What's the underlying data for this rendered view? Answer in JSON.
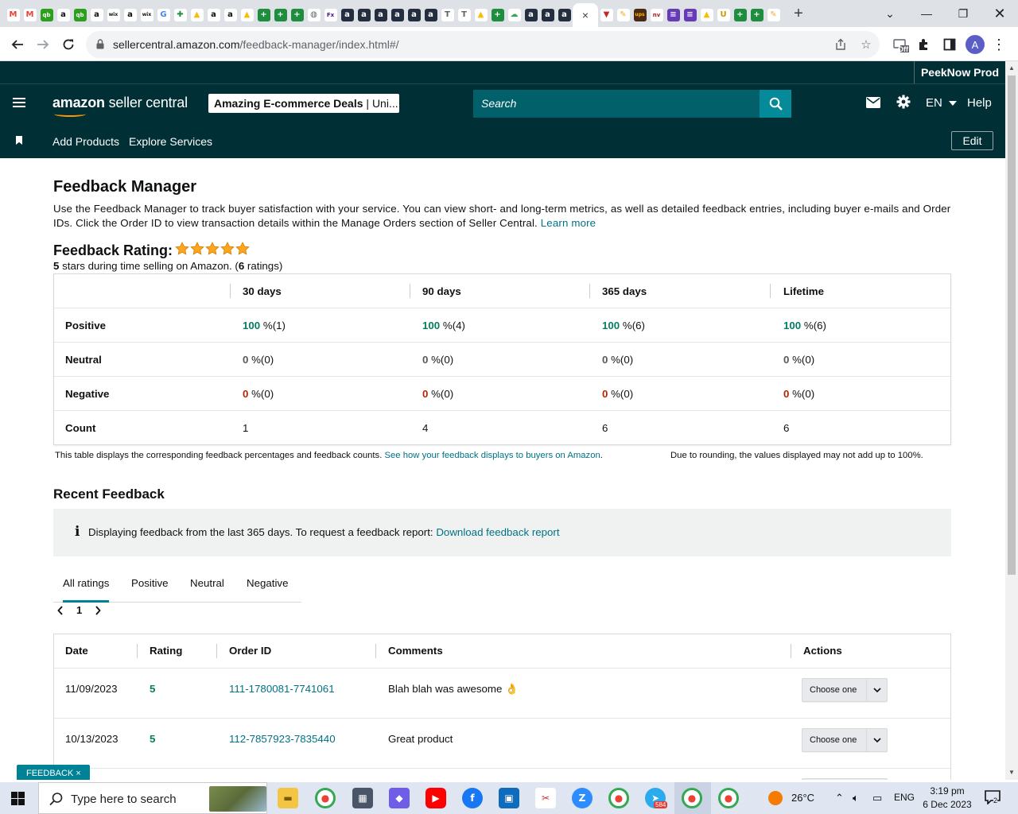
{
  "browser": {
    "active_tab_close": "×",
    "new_tab": "+",
    "tab_favicons": [
      {
        "icon": "gmail-icon",
        "bg": "#ffffff",
        "fg": "#ea4335",
        "glyph": "M"
      },
      {
        "icon": "gmail-icon",
        "bg": "#ffffff",
        "fg": "#ea4335",
        "glyph": "M"
      },
      {
        "icon": "quickbooks-icon",
        "bg": "#2ca01c",
        "fg": "#fff",
        "glyph": "qb"
      },
      {
        "icon": "amazon-icon",
        "bg": "#ffffff",
        "fg": "#111",
        "glyph": "a"
      },
      {
        "icon": "quickbooks-icon",
        "bg": "#2ca01c",
        "fg": "#fff",
        "glyph": "qb"
      },
      {
        "icon": "amazon-icon",
        "bg": "#ffffff",
        "fg": "#111",
        "glyph": "a"
      },
      {
        "icon": "wix-icon",
        "bg": "#ffffff",
        "fg": "#111",
        "glyph": "wix"
      },
      {
        "icon": "amazon-icon",
        "bg": "#ffffff",
        "fg": "#111",
        "glyph": "a"
      },
      {
        "icon": "wix-icon",
        "bg": "#ffffff",
        "fg": "#111",
        "glyph": "wix"
      },
      {
        "icon": "google-icon",
        "bg": "#ffffff",
        "fg": "#4285f4",
        "glyph": "G"
      },
      {
        "icon": "puzzle-icon",
        "bg": "#ffffff",
        "fg": "#1e8e3e",
        "glyph": "✚"
      },
      {
        "icon": "drive-icon",
        "bg": "#ffffff",
        "fg": "#fbbc04",
        "glyph": "▲"
      },
      {
        "icon": "amazon-icon",
        "bg": "#ffffff",
        "fg": "#111",
        "glyph": "a"
      },
      {
        "icon": "amazon-icon",
        "bg": "#ffffff",
        "fg": "#111",
        "glyph": "a"
      },
      {
        "icon": "drive-icon",
        "bg": "#ffffff",
        "fg": "#fbbc04",
        "glyph": "▲"
      },
      {
        "icon": "sheets-plus-icon",
        "bg": "#1e8e3e",
        "fg": "#fff",
        "glyph": "+"
      },
      {
        "icon": "sheets-plus-icon",
        "bg": "#1e8e3e",
        "fg": "#fff",
        "glyph": "+"
      },
      {
        "icon": "sheets-plus-icon",
        "bg": "#1e8e3e",
        "fg": "#fff",
        "glyph": "+"
      },
      {
        "icon": "globe-icon",
        "bg": "#ffffff",
        "fg": "#5f6368",
        "glyph": "◍"
      },
      {
        "icon": "fedex-icon",
        "bg": "#ffffff",
        "fg": "#4d148c",
        "glyph": "Fx"
      },
      {
        "icon": "amazon-box-icon",
        "bg": "#232f3e",
        "fg": "#fff",
        "glyph": "a"
      },
      {
        "icon": "amazon-box-icon",
        "bg": "#232f3e",
        "fg": "#fff",
        "glyph": "a"
      },
      {
        "icon": "amazon-box-icon",
        "bg": "#232f3e",
        "fg": "#fff",
        "glyph": "a"
      },
      {
        "icon": "amazon-box-icon",
        "bg": "#232f3e",
        "fg": "#fff",
        "glyph": "a"
      },
      {
        "icon": "amazon-box-icon",
        "bg": "#232f3e",
        "fg": "#fff",
        "glyph": "a"
      },
      {
        "icon": "amazon-box-icon",
        "bg": "#232f3e",
        "fg": "#fff",
        "glyph": "a"
      },
      {
        "icon": "typography-icon",
        "bg": "#ffffff",
        "fg": "#5f6368",
        "glyph": "T"
      },
      {
        "icon": "typography-icon",
        "bg": "#ffffff",
        "fg": "#5f6368",
        "glyph": "T"
      },
      {
        "icon": "drive-icon",
        "bg": "#ffffff",
        "fg": "#fbbc04",
        "glyph": "▲"
      },
      {
        "icon": "sheets-plus-icon",
        "bg": "#1e8e3e",
        "fg": "#fff",
        "glyph": "+"
      },
      {
        "icon": "cloud-icon",
        "bg": "#ffffff",
        "fg": "#34a853",
        "glyph": "☁"
      },
      {
        "icon": "amazon-box-icon",
        "bg": "#232f3e",
        "fg": "#fff",
        "glyph": "a"
      },
      {
        "icon": "amazon-box-icon",
        "bg": "#232f3e",
        "fg": "#fff",
        "glyph": "a"
      },
      {
        "icon": "amazon-box-icon",
        "bg": "#232f3e",
        "fg": "#fff",
        "glyph": "a"
      }
    ],
    "tab_favicons_right": [
      {
        "icon": "vivaldi-icon",
        "bg": "#ffffff",
        "fg": "#c62828",
        "glyph": "▼"
      },
      {
        "icon": "pencil-icon",
        "bg": "#ffffff",
        "fg": "#f9a825",
        "glyph": "✎"
      },
      {
        "icon": "ups-icon",
        "bg": "#4a2a12",
        "fg": "#ffb500",
        "glyph": "ups"
      },
      {
        "icon": "nav-icon",
        "bg": "#ffffff",
        "fg": "#b71c1c",
        "glyph": "nv"
      },
      {
        "icon": "forms-icon",
        "bg": "#673ab7",
        "fg": "#fff",
        "glyph": "≡"
      },
      {
        "icon": "forms-icon",
        "bg": "#673ab7",
        "fg": "#fff",
        "glyph": "≡"
      },
      {
        "icon": "drive-icon",
        "bg": "#ffffff",
        "fg": "#fbbc04",
        "glyph": "▲"
      },
      {
        "icon": "uline-icon",
        "bg": "#ffffff",
        "fg": "#c99700",
        "glyph": "U"
      },
      {
        "icon": "sheets-plus-icon",
        "bg": "#1e8e3e",
        "fg": "#fff",
        "glyph": "+"
      },
      {
        "icon": "sheets-plus-icon",
        "bg": "#1e8e3e",
        "fg": "#fff",
        "glyph": "+"
      },
      {
        "icon": "pencil-icon",
        "bg": "#ffffff",
        "fg": "#f9a825",
        "glyph": "✎"
      }
    ],
    "url_host": "sellercentral.amazon.com",
    "url_path": "/feedback-manager/index.html#/",
    "profile_initial": "A",
    "extension_badge": "Off"
  },
  "header": {
    "account_name": "PeekNow Prod",
    "logo_primary": "amazon",
    "logo_secondary": " seller central",
    "store_name": "Amazing E-commerce Deals",
    "store_market": " | Uni...",
    "search_placeholder": "Search",
    "language": "EN",
    "help": "Help"
  },
  "subnav": {
    "items": [
      "Add Products",
      "Explore Services"
    ],
    "edit": "Edit"
  },
  "main": {
    "title": "Feedback Manager",
    "intro": "Use the Feedback Manager to track buyer satisfaction with your service. You can view short- and long-term metrics, as well as detailed feedback entries, including buyer e-mails and Order IDs. Click the Order ID to view transaction details within the Manage Orders section of Seller Central. ",
    "learn_more": "Learn more",
    "rating_label": "Feedback Rating:",
    "rating_stars": 5,
    "rating_sub_stars": "5",
    "rating_sub_mid": " stars during time selling on Amazon. (",
    "rating_sub_count": "6",
    "rating_sub_end": " ratings)"
  },
  "metrics": {
    "columns": [
      "30 days",
      "90 days",
      "365 days",
      "Lifetime"
    ],
    "rows": [
      {
        "label": "Positive",
        "kind": "pos",
        "values": [
          [
            "100",
            " %(1)"
          ],
          [
            "100",
            " %(4)"
          ],
          [
            "100",
            " %(6)"
          ],
          [
            "100",
            " %(6)"
          ]
        ]
      },
      {
        "label": "Neutral",
        "kind": "neu",
        "values": [
          [
            "0",
            " %(0)"
          ],
          [
            "0",
            " %(0)"
          ],
          [
            "0",
            " %(0)"
          ],
          [
            "0",
            " %(0)"
          ]
        ]
      },
      {
        "label": "Negative",
        "kind": "neg",
        "values": [
          [
            "0",
            " %(0)"
          ],
          [
            "0",
            " %(0)"
          ],
          [
            "0",
            " %(0)"
          ],
          [
            "0",
            " %(0)"
          ]
        ]
      },
      {
        "label": "Count",
        "kind": "count",
        "values": [
          [
            "",
            "1"
          ],
          [
            "",
            "4"
          ],
          [
            "",
            "6"
          ],
          [
            "",
            "6"
          ]
        ]
      }
    ],
    "note": "This table displays the corresponding feedback percentages and feedback counts. ",
    "note_link": "See how your feedback displays to buyers on Amazon",
    "note_end": ".",
    "rounding_note": "Due to rounding, the values displayed may not add up to 100%."
  },
  "recent": {
    "title": "Recent Feedback",
    "info_icon": "i",
    "info_text": "Displaying feedback from the last 365 days. To request a feedback report: ",
    "info_link": "Download feedback report",
    "tabs": [
      "All ratings",
      "Positive",
      "Neutral",
      "Negative"
    ],
    "page": "1",
    "table_headers": [
      "Date",
      "Rating",
      "Order ID",
      "Comments",
      "Actions"
    ],
    "rows": [
      {
        "date": "11/09/2023",
        "rating": "5",
        "order_id": "111-1780081-7741061",
        "comment": "Blah blah was awesome 👌",
        "action": "Choose one"
      },
      {
        "date": "10/13/2023",
        "rating": "5",
        "order_id": "112-7857923-7835440",
        "comment": "Great product",
        "action": "Choose one"
      }
    ],
    "feedback_pill": "FEEDBACK ×"
  },
  "taskbar": {
    "search_placeholder": "Type here to search",
    "weather": "26°C",
    "language": "ENG",
    "time": "3:19 pm",
    "date": "6 Dec 2023",
    "notifications": "2",
    "telegram_badge": "584"
  },
  "colors": {
    "header_bg": "#002f36",
    "link": "#007185",
    "positive": "#067d62",
    "negative": "#b12704",
    "star": "#ffa41c"
  }
}
